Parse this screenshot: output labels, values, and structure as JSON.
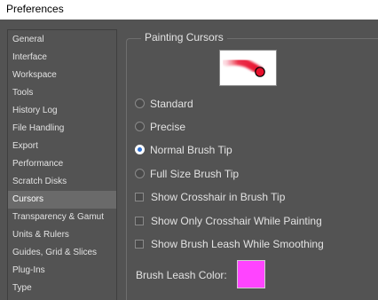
{
  "window": {
    "title": "Preferences"
  },
  "sidebar": {
    "items": [
      {
        "label": "General"
      },
      {
        "label": "Interface"
      },
      {
        "label": "Workspace"
      },
      {
        "label": "Tools"
      },
      {
        "label": "History Log"
      },
      {
        "label": "File Handling"
      },
      {
        "label": "Export"
      },
      {
        "label": "Performance"
      },
      {
        "label": "Scratch Disks"
      },
      {
        "label": "Cursors",
        "selected": true
      },
      {
        "label": "Transparency & Gamut"
      },
      {
        "label": "Units & Rulers"
      },
      {
        "label": "Guides, Grid & Slices"
      },
      {
        "label": "Plug-Ins"
      },
      {
        "label": "Type"
      }
    ]
  },
  "painting_cursors": {
    "title": "Painting Cursors",
    "options": [
      {
        "label": "Standard",
        "checked": false
      },
      {
        "label": "Precise",
        "checked": false
      },
      {
        "label": "Normal Brush Tip",
        "checked": true
      },
      {
        "label": "Full Size Brush Tip",
        "checked": false
      }
    ],
    "checkboxes": [
      {
        "label": "Show Crosshair in Brush Tip",
        "checked": false
      },
      {
        "label": "Show Only Crosshair While Painting",
        "checked": false
      },
      {
        "label": "Show Brush Leash While Smoothing",
        "checked": false
      }
    ],
    "brush_leash_label": "Brush Leash Color:",
    "brush_leash_color": "#ff44ff"
  },
  "colors": {
    "background": "#535353",
    "stroke": "#e8102c",
    "radio_selected_dot": "#2f6fcf"
  }
}
